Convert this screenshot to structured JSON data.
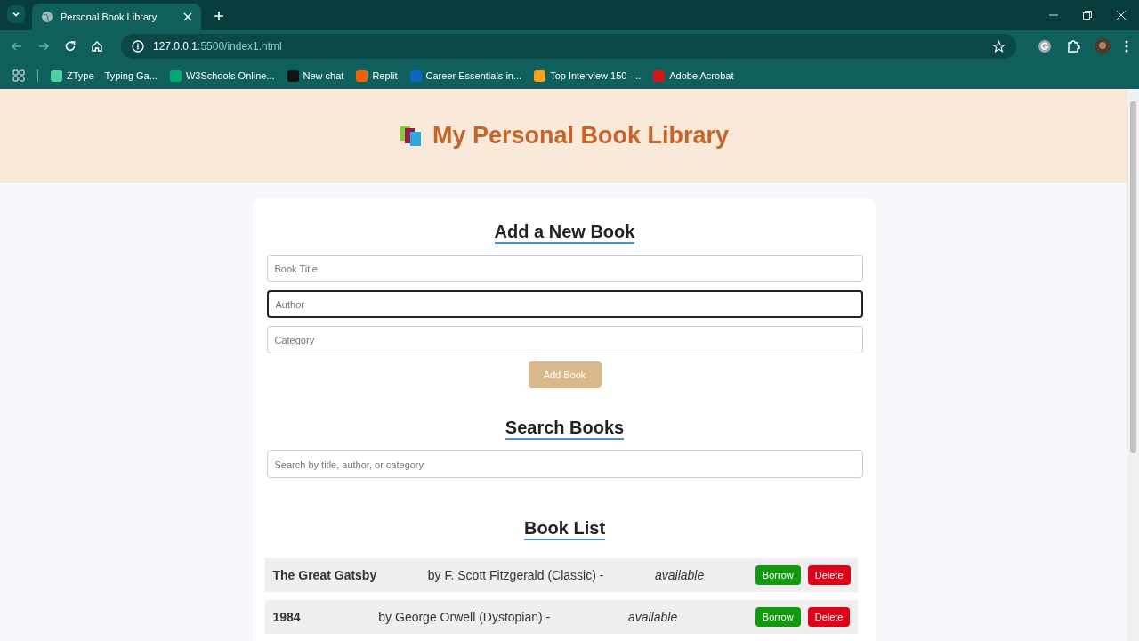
{
  "browser": {
    "tab_title": "Personal Book Library",
    "url_host": "127.0.0.1",
    "url_path": ":5500/index1.html",
    "bookmarks": [
      {
        "label": "ZType – Typing Ga...",
        "kind": "ztype"
      },
      {
        "label": "W3Schools Online...",
        "kind": "w3"
      },
      {
        "label": "New chat",
        "kind": "chat"
      },
      {
        "label": "Replit",
        "kind": "replit"
      },
      {
        "label": "Career Essentials in...",
        "kind": "video"
      },
      {
        "label": "Top Interview 150 -...",
        "kind": "leet"
      },
      {
        "label": "Adobe Acrobat",
        "kind": "pdf"
      }
    ]
  },
  "header": {
    "title": "My Personal Book Library"
  },
  "add_form": {
    "heading": "Add a New Book",
    "fields": [
      {
        "placeholder": "Book Title",
        "focused": false
      },
      {
        "placeholder": "Author",
        "focused": true
      },
      {
        "placeholder": "Category",
        "focused": false
      }
    ],
    "button": "Add Book"
  },
  "search": {
    "heading": "Search Books",
    "placeholder": "Search by title, author, or category"
  },
  "book_list": {
    "heading": "Book List",
    "books": [
      {
        "title": "The Great Gatsby",
        "details": "by F. Scott Fitzgerald (Classic) -",
        "status": "available",
        "borrow": "Borrow",
        "delete": "Delete"
      },
      {
        "title": "1984",
        "details": "by George Orwell (Dystopian) -",
        "status": "available",
        "borrow": "Borrow",
        "delete": "Delete"
      }
    ]
  }
}
